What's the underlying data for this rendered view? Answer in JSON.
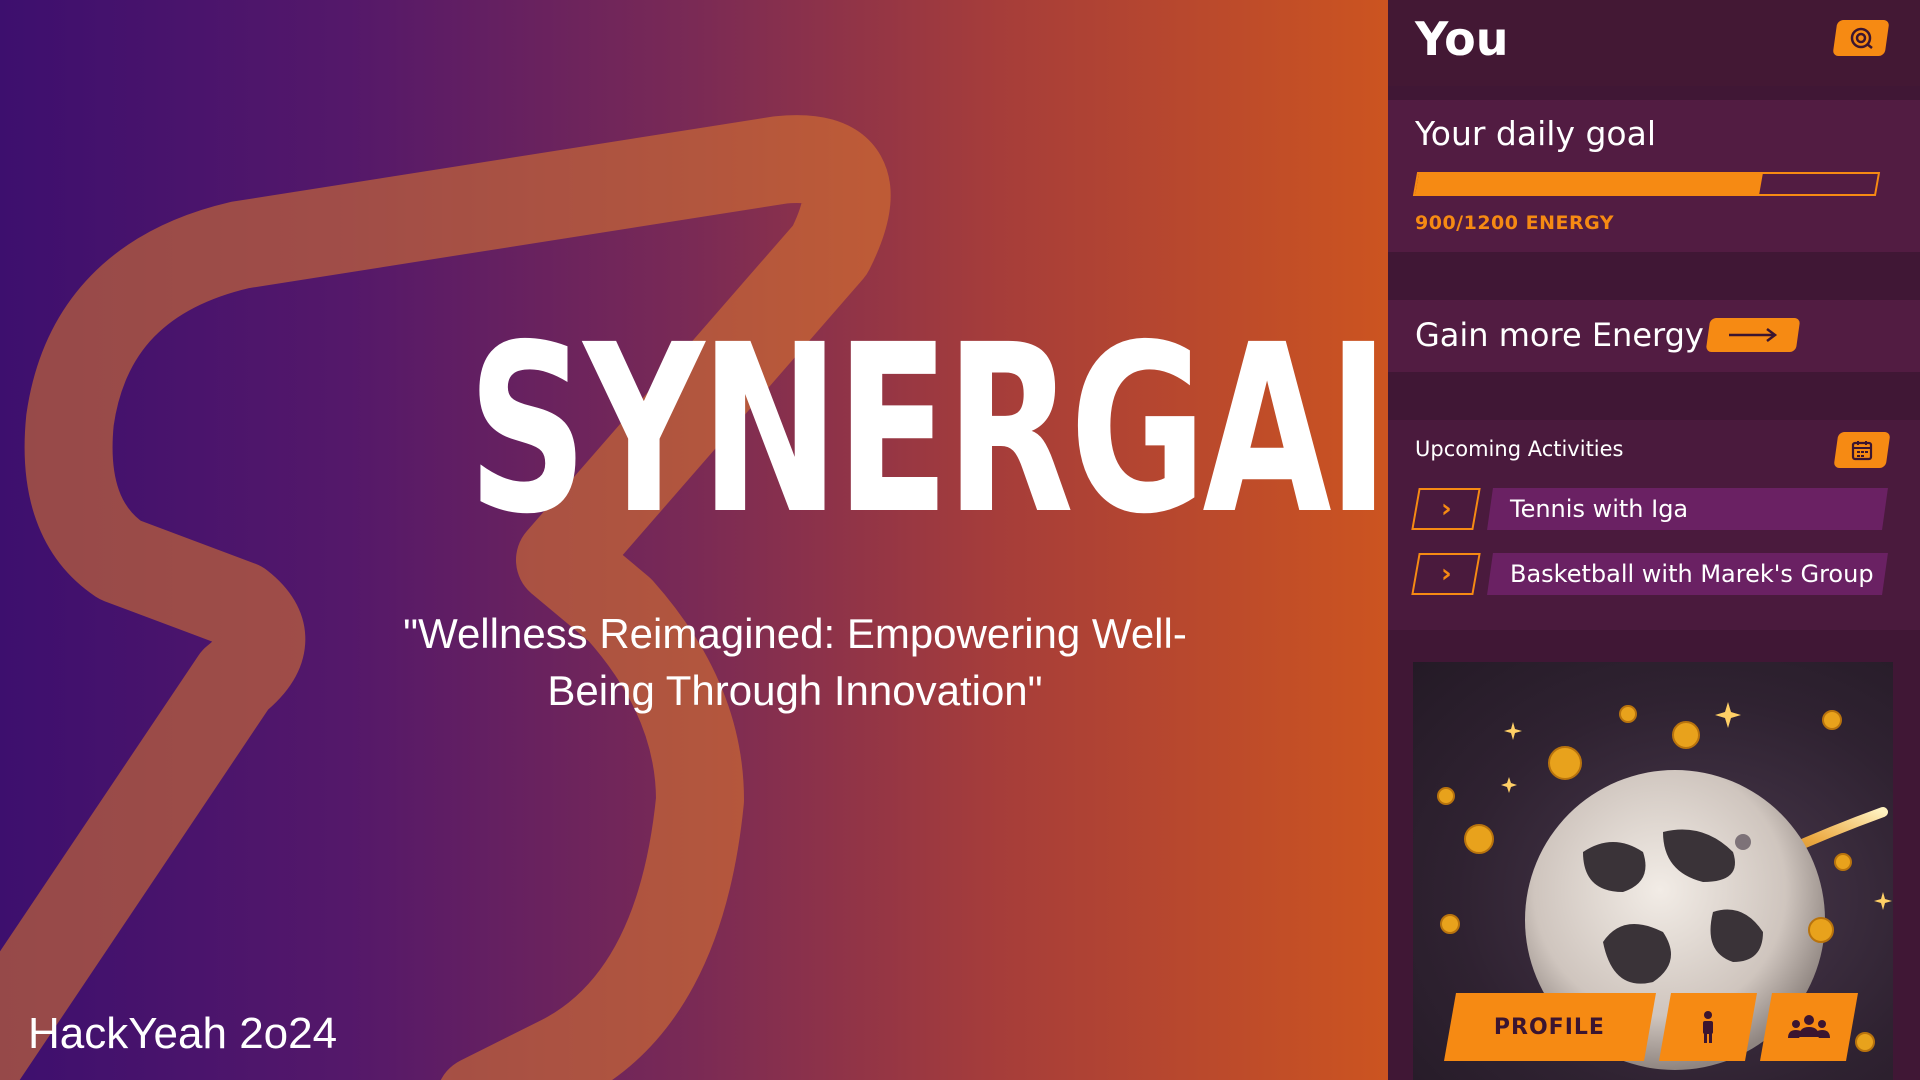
{
  "hero": {
    "title": "SYNERGAIN",
    "tagline_line1": "\"Wellness Reimagined: Empowering Well-",
    "tagline_line2": "Being Through Innovation\"",
    "event": "HackYeah 2o24"
  },
  "panel": {
    "title": "You",
    "header_icon": "eye-target-icon",
    "daily_goal": {
      "label": "Your daily goal",
      "value_text": "900/1200 ENERGY",
      "progress": 0.75
    },
    "gain_energy": {
      "label": "Gain more Energy",
      "icon": "arrow-right-icon"
    },
    "activities": {
      "title": "Upcoming Activities",
      "icon": "calendar-icon",
      "items": [
        {
          "label": "Tennis with Iga"
        },
        {
          "label": "Basketball with Marek's Group"
        }
      ]
    },
    "nav": {
      "profile_label": "PROFILE",
      "person_icon": "person-icon",
      "group_icon": "group-icon"
    }
  },
  "colors": {
    "accent": "#f68a13",
    "panel_bg": "#401735",
    "card_bg": "#521c42",
    "gradient_start": "#3d0f6e",
    "gradient_end": "#cc5420"
  }
}
